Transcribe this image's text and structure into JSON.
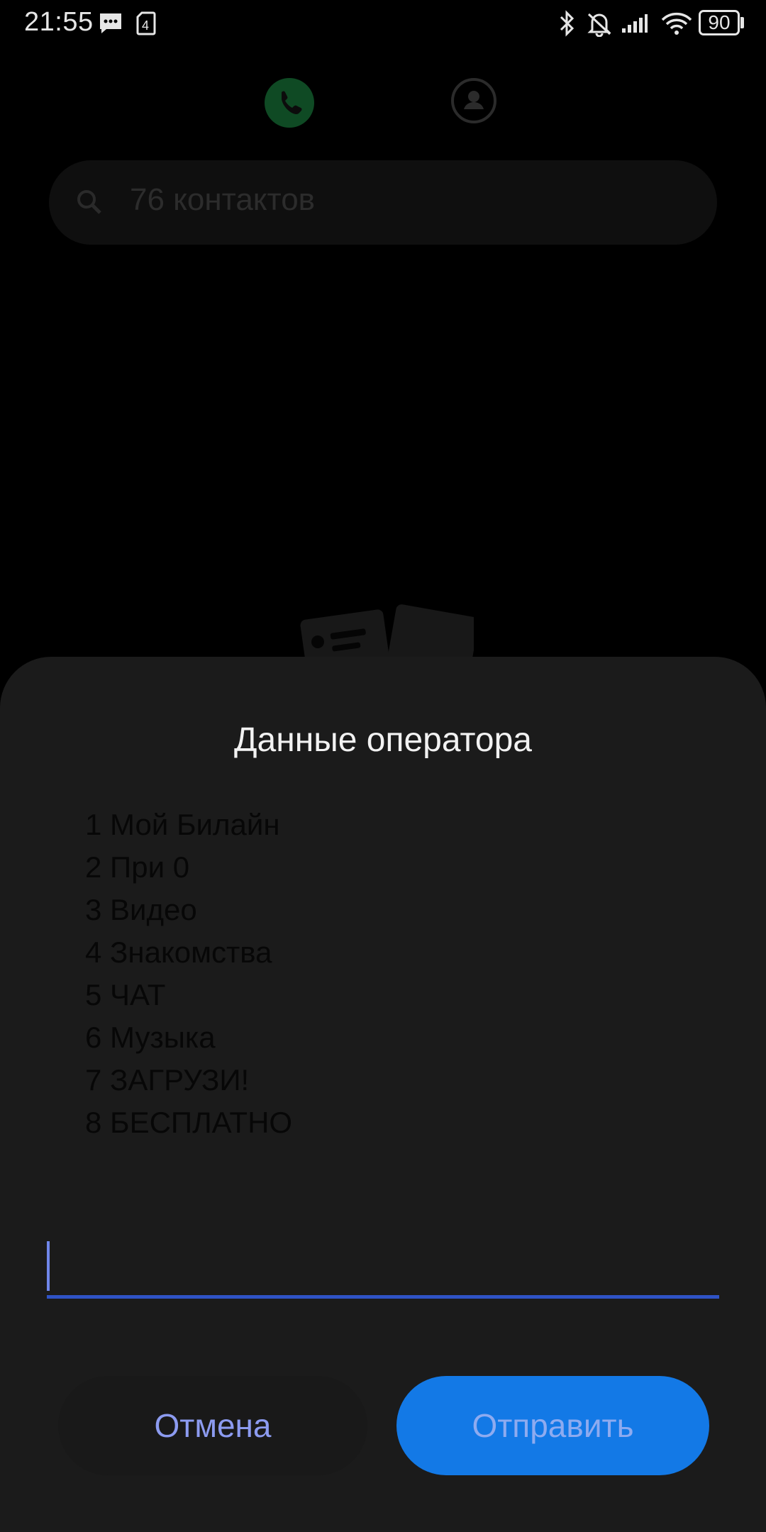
{
  "status_bar": {
    "time": "21:55",
    "battery": "90",
    "icons": [
      "message-icon",
      "sim-icon",
      "bluetooth-icon",
      "mute-icon",
      "signal-icon",
      "wifi-icon"
    ]
  },
  "background": {
    "search_placeholder": "76 контактов",
    "tabs": [
      "phone-tab-icon",
      "contacts-tab-icon"
    ]
  },
  "dialog": {
    "title": "Данные оператора",
    "menu_items": [
      "1 Мой Билайн",
      "2 При 0",
      "3 Видео",
      "4 Знакомства",
      "5 ЧАТ",
      "6 Музыка",
      "7 ЗАГРУЗИ!",
      "8 БЕСПЛАТНО"
    ],
    "input_value": "",
    "cancel_label": "Отмена",
    "send_label": "Отправить"
  },
  "colors": {
    "accent": "#1379e6",
    "button_text": "#8c9bf0",
    "underline": "#2f53c6",
    "dialog_bg": "#1b1b1b"
  }
}
